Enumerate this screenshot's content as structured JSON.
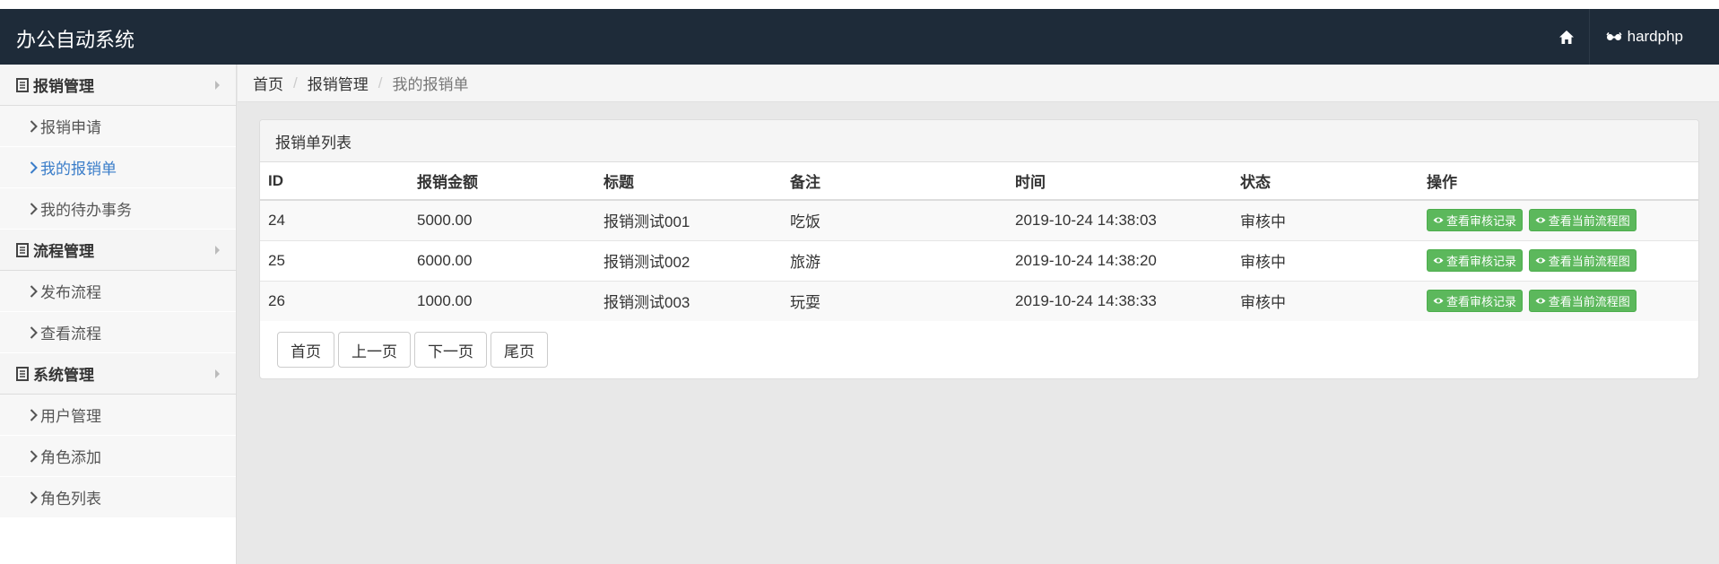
{
  "app": {
    "title": "办公自动系统",
    "user": "hardphp"
  },
  "icons": {
    "home": "home-icon",
    "user": "glasses-icon",
    "book": "book-icon",
    "chevron": "chevron-right-icon",
    "eye": "eye-icon"
  },
  "colors": {
    "navbar": "#1e2b39",
    "active_link": "#3a7dc9",
    "action_button": "#5cb85c"
  },
  "sidebar": {
    "groups": [
      {
        "label": "报销管理",
        "items": [
          "报销申请",
          "我的报销单",
          "我的待办事务"
        ]
      },
      {
        "label": "流程管理",
        "items": [
          "发布流程",
          "查看流程"
        ]
      },
      {
        "label": "系统管理",
        "items": [
          "用户管理",
          "角色添加",
          "角色列表"
        ]
      }
    ],
    "active_item": "我的报销单"
  },
  "breadcrumb": {
    "items": [
      "首页",
      "报销管理"
    ],
    "current": "我的报销单",
    "separator": "/"
  },
  "panel": {
    "title": "报销单列表"
  },
  "table": {
    "headers": [
      "ID",
      "报销金额",
      "标题",
      "备注",
      "时间",
      "状态",
      "操作"
    ],
    "rows": [
      {
        "id": "24",
        "amount": "5000.00",
        "title": "报销测试001",
        "note": "吃饭",
        "time": "2019-10-24 14:38:03",
        "status": "审核中"
      },
      {
        "id": "25",
        "amount": "6000.00",
        "title": "报销测试002",
        "note": "旅游",
        "time": "2019-10-24 14:38:20",
        "status": "审核中"
      },
      {
        "id": "26",
        "amount": "1000.00",
        "title": "报销测试003",
        "note": "玩耍",
        "time": "2019-10-24 14:38:33",
        "status": "审核中"
      }
    ],
    "actions": {
      "view_audit": "查看审核记录",
      "view_flow": "查看当前流程图"
    }
  },
  "pager": {
    "first": "首页",
    "prev": "上一页",
    "next": "下一页",
    "last": "尾页"
  }
}
